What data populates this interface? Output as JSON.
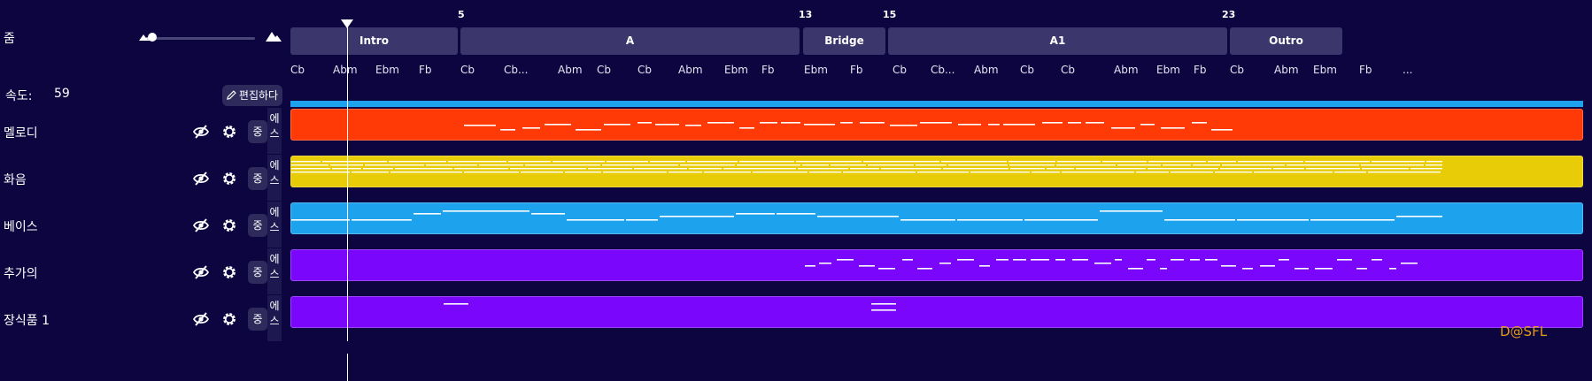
{
  "left_panel": {
    "zoom_label": "줌",
    "zoom_level": 0.05,
    "speed_label": "속도:",
    "speed_value": "59",
    "edit_label": "편집하다",
    "icons": {
      "zoom_out": "mountain-small-icon",
      "zoom_in": "mountain-big-icon",
      "edit": "pencil-icon",
      "hide": "eye-off-icon",
      "settings": "gear-icon"
    }
  },
  "tracks": [
    {
      "name": "멜로디",
      "mid_label": "중",
      "solo_label_1": "에",
      "solo_label_2": "스",
      "color": "#ff3a06"
    },
    {
      "name": "화음",
      "mid_label": "중",
      "solo_label_1": "에",
      "solo_label_2": "스",
      "color": "#e8cc07"
    },
    {
      "name": "베이스",
      "mid_label": "중",
      "solo_label_1": "에",
      "solo_label_2": "스",
      "color": "#1da3ee"
    },
    {
      "name": "추가의",
      "mid_label": "중",
      "solo_label_1": "에",
      "solo_label_2": "스",
      "color": "#7a06fb"
    },
    {
      "name": "장식품 1",
      "mid_label": "중",
      "solo_label_1": "에",
      "solo_label_2": "스",
      "color": "#7a06fb"
    }
  ],
  "timeline": {
    "measures": [
      "5",
      "13",
      "15",
      "23"
    ],
    "sections": [
      "Intro",
      "A",
      "Bridge",
      "A1",
      "Outro"
    ],
    "chords": [
      "Cb",
      "Abm",
      "Ebm",
      "Fb",
      "Cb",
      "Cb...",
      "Abm",
      "Cb",
      "Cb",
      "Abm",
      "Ebm",
      "Fb",
      "Ebm",
      "Fb",
      "Cb",
      "Cb...",
      "Abm",
      "Cb",
      "Cb",
      "Abm",
      "Ebm",
      "Fb",
      "Cb",
      "Abm",
      "Ebm",
      "Fb",
      "..."
    ]
  },
  "watermark": "D@SFL"
}
